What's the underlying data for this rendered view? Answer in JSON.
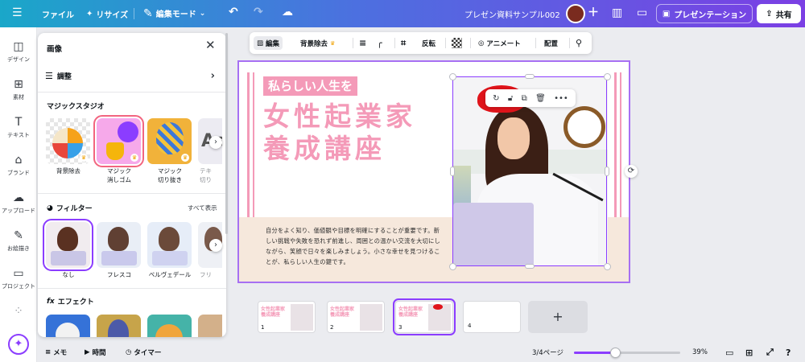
{
  "topbar": {
    "menu_icon": "hamburger-icon",
    "file": "ファイル",
    "resize": "リサイズ",
    "edit_mode": "編集モード",
    "doc_title": "プレゼン資料サンプル002",
    "present": "プレゼンテーション",
    "share": "共有"
  },
  "sidebar": {
    "items": [
      {
        "label": "デザイン",
        "icon": "design-icon"
      },
      {
        "label": "素材",
        "icon": "elements-icon"
      },
      {
        "label": "テキスト",
        "icon": "text-icon"
      },
      {
        "label": "ブランド",
        "icon": "brand-icon"
      },
      {
        "label": "アップロード",
        "icon": "upload-icon"
      },
      {
        "label": "お絵描き",
        "icon": "draw-icon"
      },
      {
        "label": "プロジェクト",
        "icon": "folder-icon"
      }
    ]
  },
  "panel": {
    "title": "画像",
    "adjust": "調整",
    "magic_studio": "マジックスタジオ",
    "magic_tools": [
      {
        "label": "背景除去"
      },
      {
        "label": "マジック\n消しゴム"
      },
      {
        "label": "マジック\n切り抜き"
      },
      {
        "label": "テキ\n切り"
      }
    ],
    "filter_title": "フィルター",
    "see_all": "すべて表示",
    "filters": [
      {
        "label": "なし"
      },
      {
        "label": "フレスコ"
      },
      {
        "label": "ベルヴェデール"
      },
      {
        "label": "フリ"
      }
    ],
    "effect_title": "エフェクト"
  },
  "toolbar": {
    "edit": "編集",
    "bg_remove": "背景除去",
    "flip": "反転",
    "animate": "アニメート",
    "position": "配置"
  },
  "slide": {
    "subtitle": "私らしい人生を",
    "title": "女性起業家\n養成講座",
    "body": "自分をよく知り、価値観や目標を明確にすることが重要です。新しい挑戦や失敗を恐れず前進し、周囲との温かい交流を大切にしながら、笑顔で日々を楽しみましょう。小さな幸せを見つけることが、私らしい人生の鍵です。"
  },
  "thumbnails": [
    {
      "num": "1",
      "title": "女性起業家\n養成講座"
    },
    {
      "num": "2",
      "title": "女性起業家\n養成講座"
    },
    {
      "num": "3",
      "title": "女性起業家\n養成講座"
    },
    {
      "num": "4",
      "title": ""
    }
  ],
  "bottom": {
    "notes": "メモ",
    "time": "時間",
    "timer": "タイマー",
    "page_indicator": "3/4ページ",
    "zoom": "39%",
    "zoom_fraction": 0.39
  }
}
